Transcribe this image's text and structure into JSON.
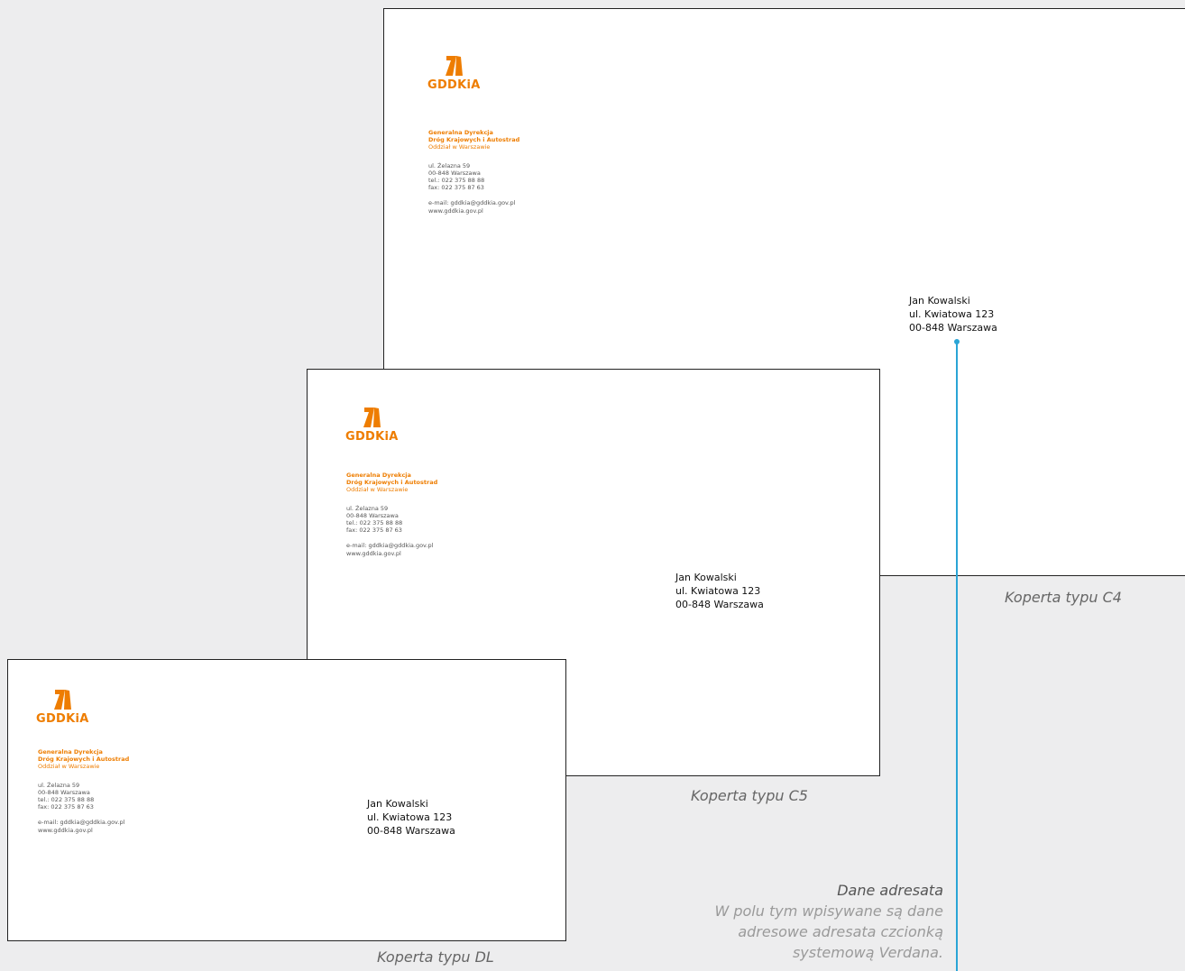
{
  "sender": {
    "logo_text": "GDDKiA",
    "org_line1": "Generalna Dyrekcja",
    "org_line2": "Dróg Krajowych i Autostrad",
    "branch": "Oddział w Warszawie",
    "street": "ul. Żelazna 59",
    "city": "00-848 Warszawa",
    "tel": "tel.: 022 375 88 88",
    "fax": "fax: 022 375 87 63",
    "email": "e-mail: gddkia@gddkia.gov.pl",
    "www": "www.gddkia.gov.pl"
  },
  "recipient": {
    "name": "Jan Kowalski",
    "street": "ul. Kwiatowa 123",
    "city": "00-848 Warszawa"
  },
  "captions": {
    "c4": "Koperta typu C4",
    "c5": "Koperta typu C5",
    "dl": "Koperta typu DL"
  },
  "annotation": {
    "title": "Dane adresata",
    "line1": "W polu tym wpisywane są dane",
    "line2": "adresowe adresata czcionką",
    "line3": "systemową Verdana."
  },
  "colors": {
    "brand_orange": "#ee7d00",
    "leader_blue": "#2aa5d6",
    "background": "#ededee"
  }
}
